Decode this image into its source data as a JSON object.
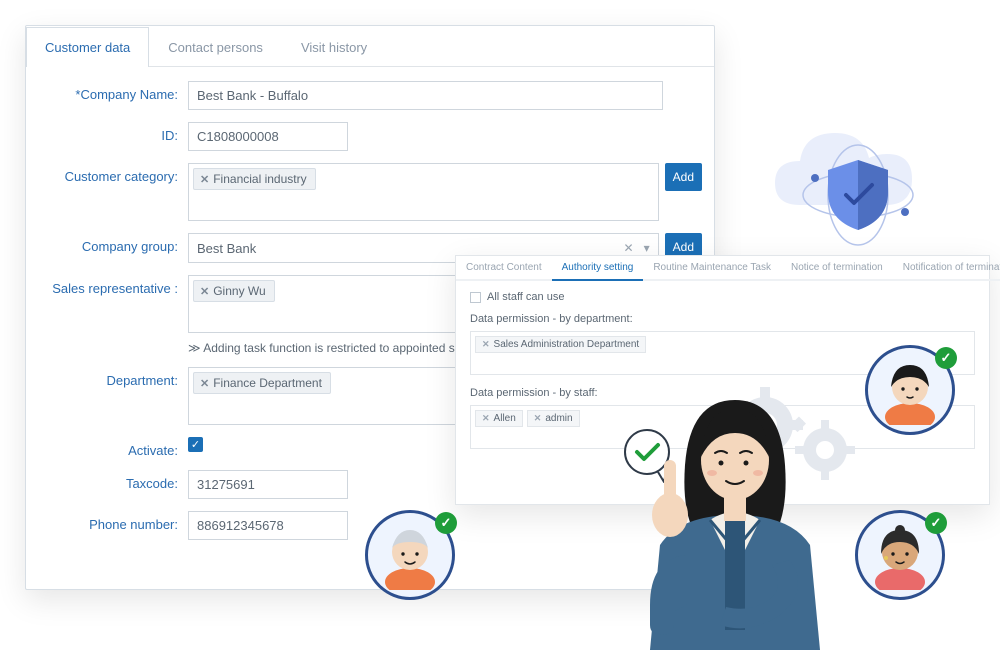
{
  "tabs": [
    {
      "label": "Customer data",
      "active": true
    },
    {
      "label": "Contact persons",
      "active": false
    },
    {
      "label": "Visit history",
      "active": false
    }
  ],
  "form": {
    "company_name_label": "*Company Name:",
    "company_name_value": "Best Bank - Buffalo",
    "id_label": "ID:",
    "id_value": "C1808000008",
    "category_label": "Customer category:",
    "category_tag": "Financial industry",
    "company_group_label": "Company group:",
    "company_group_value": "Best Bank",
    "sales_rep_label": "Sales representative :",
    "sales_rep_tag": "Ginny Wu",
    "sales_rep_note": "Adding task function is restricted to appointed sal",
    "department_label": "Department:",
    "department_tag": "Finance Department",
    "activate_label": "Activate:",
    "activate_checked": true,
    "taxcode_label": "Taxcode:",
    "taxcode_value": "31275691",
    "phone_label": "Phone number:",
    "phone_value": "886912345678",
    "add_button": "Add"
  },
  "authority": {
    "tabs": [
      {
        "label": "Contract Content",
        "active": false
      },
      {
        "label": "Authority setting",
        "active": true
      },
      {
        "label": "Routine Maintenance Task",
        "active": false
      },
      {
        "label": "Notice of termination",
        "active": false
      },
      {
        "label": "Notification of terminated contract",
        "active": false
      }
    ],
    "all_staff_label": "All staff can use",
    "by_dept_label": "Data permission - by department:",
    "dept_tag": "Sales Administration Department",
    "by_staff_label": "Data permission - by staff:",
    "staff_tags": [
      "Allen",
      "admin"
    ]
  }
}
